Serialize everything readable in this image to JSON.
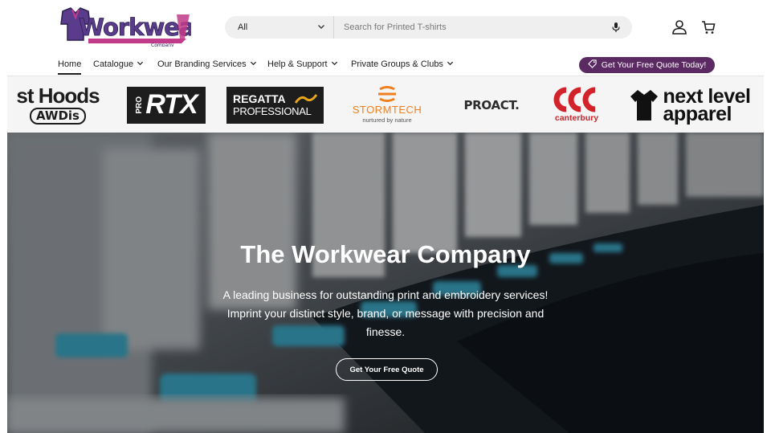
{
  "header": {
    "logo_text": "Workwear",
    "logo_sub": "Company",
    "search": {
      "category": "All",
      "placeholder": "Search for Printed T-shirts"
    },
    "icons": [
      "user-icon",
      "cart-icon"
    ]
  },
  "nav": {
    "items": [
      {
        "label": "Home",
        "active": true
      },
      {
        "label": "Catalogue",
        "dropdown": true
      },
      {
        "label": "Our Branding Services",
        "dropdown": true
      },
      {
        "label": "Help & Support",
        "dropdown": true
      },
      {
        "label": "Private Groups & Clubs",
        "dropdown": true
      }
    ],
    "quote_button": "Get Your Free Quote Today!"
  },
  "brands": {
    "just_hoods": {
      "line1": "st Hoods",
      "line2": "AWDis"
    },
    "prortx": {
      "pro": "PRO",
      "rtx": "RTX"
    },
    "regatta": {
      "line1": "REGATTA",
      "line2": "PROFESSIONAL"
    },
    "stormtech": {
      "name": "STORMTECH",
      "tag": "nurtured by nature"
    },
    "proact": {
      "name": "PROACT."
    },
    "canterbury": {
      "name": "canterbury"
    },
    "nextlevel": {
      "line1": "next level",
      "line2": "apparel"
    }
  },
  "hero": {
    "title": "The Workwear Company",
    "subtitle": "A leading business for outstanding print and embroidery services! Imprint your distinct style, brand, or message with precision and finesse.",
    "button": "Get Your Free Quote"
  },
  "colors": {
    "accent": "#5b2a63",
    "logo_purple": "#5a3b8c",
    "logo_pink": "#c23a8a",
    "stormtech_orange": "#f07f1f",
    "canterbury_red": "#d2232a"
  }
}
